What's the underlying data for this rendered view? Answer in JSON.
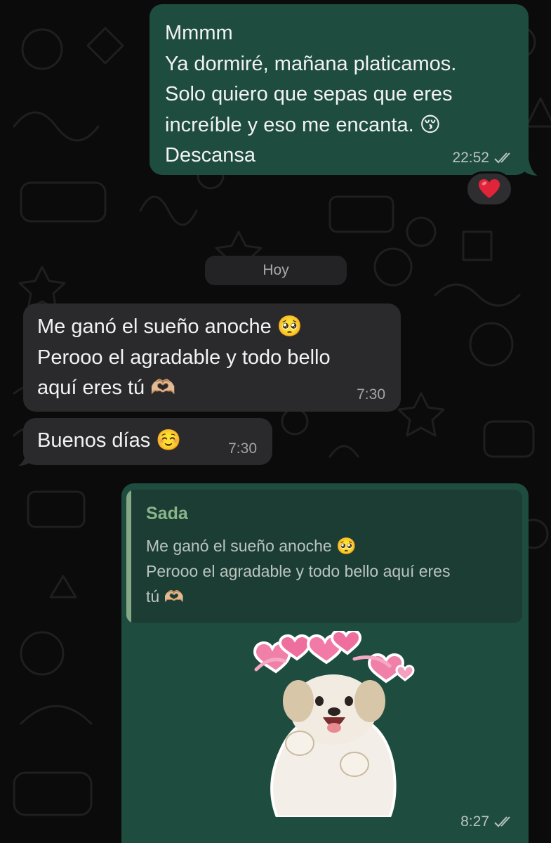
{
  "messages": [
    {
      "direction": "outgoing",
      "lines": [
        "Mmmm",
        "Ya dormiré, mañana platicamos.",
        "Solo quiero que sepas que eres",
        "increíble y eso me encanta. 😚",
        "Descansa"
      ],
      "time": "22:52",
      "status": "read",
      "reaction": "❤️"
    },
    {
      "direction": "incoming",
      "lines": [
        "Me ganó el sueño anoche 🥺",
        "Perooo el agradable y todo bello",
        "aquí eres tú 🫶🏼"
      ],
      "time": "7:30"
    },
    {
      "direction": "incoming",
      "lines": [
        "Buenos días ☺️"
      ],
      "time": "7:30"
    },
    {
      "direction": "outgoing",
      "quoted": {
        "author": "Sada",
        "lines": [
          "Me ganó el sueño anoche 🥺",
          "Perooo el agradable y todo bello aquí eres",
          "tú 🫶🏼"
        ]
      },
      "sticker": "puppy-with-hearts",
      "time": "8:27",
      "status": "read"
    }
  ],
  "date_divider": "Hoy",
  "colors": {
    "background": "#0b0b0b",
    "outgoing_bubble": "#1e4d3f",
    "incoming_bubble": "#2a2a2c",
    "quote_background": "#1b3d33",
    "quote_accent": "#85a987",
    "quote_author": "#8ab58a",
    "reaction_heart": "#e0243a"
  },
  "icons": {
    "read_receipt": "double-check-icon",
    "reaction": "heart-icon",
    "sticker": "puppy-sticker"
  },
  "texts": {
    "m1": {
      "l1": "Mmmm",
      "l2": "Ya dormiré, mañana platicamos.",
      "l3": "Solo quiero que sepas que eres",
      "l4": "increíble y eso me encanta. 😚",
      "l5": "Descansa"
    },
    "m2": {
      "l1": "Me ganó el sueño anoche 🥺",
      "l2": "Perooo el agradable y todo bello",
      "l3": "aquí eres tú 🫶🏼"
    },
    "m3": {
      "l1": "Buenos días ☺️"
    }
  }
}
